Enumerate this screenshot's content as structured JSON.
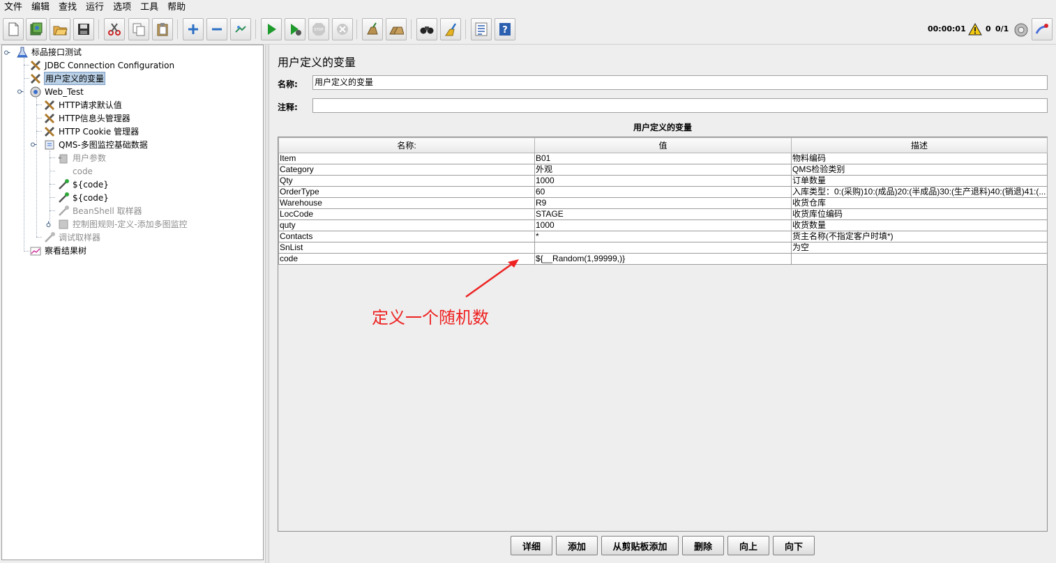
{
  "menu": [
    "文件",
    "编辑",
    "查找",
    "运行",
    "选项",
    "工具",
    "帮助"
  ],
  "toolbar": {
    "buttons": [
      "new-icon",
      "templates-icon",
      "open-icon",
      "save-icon",
      "cut-icon",
      "copy-icon",
      "paste-icon",
      "expand-icon",
      "collapse-icon",
      "toggle-icon",
      "start-icon",
      "start-no-pauses-icon",
      "stop-icon",
      "shutdown-icon",
      "clear-icon",
      "clear-all-icon",
      "search-icon",
      "reset-search-icon",
      "function-helper-icon",
      "help-icon"
    ],
    "elapsed": "00:00:01",
    "warnings": "0",
    "threads": "0/1"
  },
  "tree": [
    {
      "label": "标品接口测试",
      "icon": "test-plan-icon",
      "disabled": false,
      "selected": false
    },
    {
      "label": "JDBC Connection Configuration",
      "icon": "config-element-icon",
      "disabled": false,
      "selected": false
    },
    {
      "label": "用户定义的变量",
      "icon": "config-element-icon",
      "disabled": false,
      "selected": true
    },
    {
      "label": "Web_Test",
      "icon": "thread-group-icon",
      "disabled": false,
      "selected": false
    },
    {
      "label": "HTTP请求默认值",
      "icon": "config-element-icon",
      "disabled": false,
      "selected": false
    },
    {
      "label": "HTTP信息头管理器",
      "icon": "config-element-icon",
      "disabled": false,
      "selected": false
    },
    {
      "label": "HTTP Cookie 管理器",
      "icon": "config-element-icon",
      "disabled": false,
      "selected": false
    },
    {
      "label": "QMS-多图监控基础数据",
      "icon": "transaction-controller-icon",
      "disabled": false,
      "selected": false
    },
    {
      "label": "用户参数",
      "icon": "pre-processor-icon",
      "disabled": true,
      "selected": false
    },
    {
      "label": "code",
      "icon": "",
      "disabled": true,
      "selected": false
    },
    {
      "label": "${code}",
      "icon": "sampler-icon",
      "disabled": false,
      "selected": false
    },
    {
      "label": "${code}",
      "icon": "sampler-icon",
      "disabled": false,
      "selected": false
    },
    {
      "label": "BeanShell 取样器",
      "icon": "sampler-icon",
      "disabled": true,
      "selected": false
    },
    {
      "label": "控制图规则-定义-添加多图监控",
      "icon": "controller-icon",
      "disabled": true,
      "selected": false
    },
    {
      "label": "调试取样器",
      "icon": "sampler-icon",
      "disabled": true,
      "selected": false
    },
    {
      "label": "察看结果树",
      "icon": "listener-icon",
      "disabled": false,
      "selected": false
    }
  ],
  "panel": {
    "title": "用户定义的变量",
    "name_label": "名称:",
    "name_value": "用户定义的变量",
    "comment_label": "注释:",
    "comment_value": "",
    "table_title": "用户定义的变量"
  },
  "table": {
    "headers": [
      "名称:",
      "值",
      "描述"
    ],
    "rows": [
      [
        "Item",
        "B01",
        "物料编码"
      ],
      [
        "Category",
        "外观",
        "QMS检验类别"
      ],
      [
        "Qty",
        "1000",
        "订单数量"
      ],
      [
        "OrderType",
        "60",
        "入库类型：0:(采购)10:(成品)20:(半成品)30:(生产退料)40:(销退)41:(..."
      ],
      [
        "Warehouse",
        "R9",
        "收货仓库"
      ],
      [
        "LocCode",
        "STAGE",
        "收货库位编码"
      ],
      [
        "quty",
        "1000",
        "收货数量"
      ],
      [
        "Contacts",
        "*",
        "货主名称(不指定客户时填*)"
      ],
      [
        "SnList",
        "",
        "为空"
      ],
      [
        "code",
        "${__Random(1,99999,)}",
        ""
      ]
    ]
  },
  "buttons": {
    "detail": "详细",
    "add": "添加",
    "add_from_clipboard": "从剪贴板添加",
    "delete": "删除",
    "up": "向上",
    "down": "向下"
  },
  "annotation": {
    "text": "定义一个随机数",
    "color": "#ee2222"
  }
}
